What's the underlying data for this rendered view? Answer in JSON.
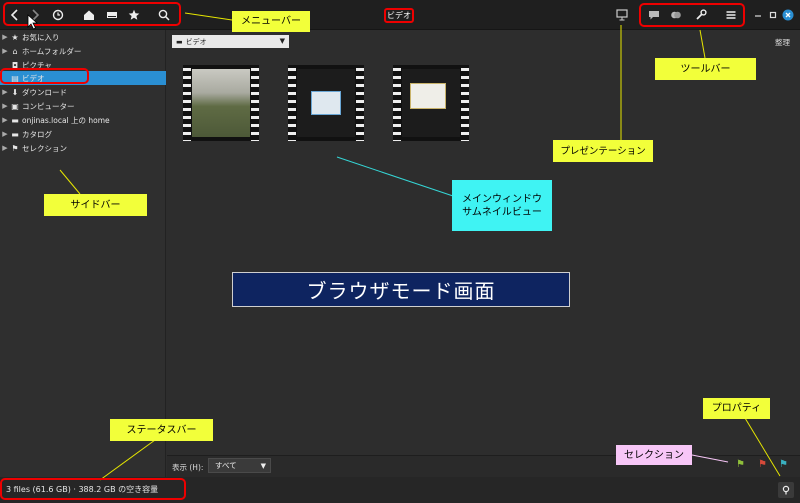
{
  "window": {
    "title": "ビデオ"
  },
  "sidebar": {
    "items": [
      {
        "label": "お気に入り",
        "icon": "star-icon",
        "expandable": true
      },
      {
        "label": "ホームフォルダー",
        "icon": "home-icon",
        "expandable": true
      },
      {
        "label": "ピクチャ",
        "icon": "camera-icon",
        "expandable": false
      },
      {
        "label": "ビデオ",
        "icon": "film-icon",
        "expandable": false,
        "selected": true
      },
      {
        "label": "ダウンロード",
        "icon": "download-icon",
        "expandable": true
      },
      {
        "label": "コンピューター",
        "icon": "computer-icon",
        "expandable": true
      },
      {
        "label": "onjinas.local 上の home",
        "icon": "folder-icon",
        "expandable": true
      },
      {
        "label": "カタログ",
        "icon": "catalog-icon",
        "expandable": true
      },
      {
        "label": "セレクション",
        "icon": "flag-icon",
        "expandable": true
      }
    ]
  },
  "location": {
    "folder": "ビデオ",
    "organize_label": "整理"
  },
  "viewbar": {
    "label": "表示 (H):",
    "selected": "すべて"
  },
  "status": {
    "text": "3 files (61.6 GB)  ·  388.2 GB の空き容量"
  },
  "annotations": {
    "menubar": "メニューバー",
    "toolbar": "ツールバー",
    "presentation": "プレゼンテーション",
    "sidebar": "サイドバー",
    "main_line1": "メインウィンドウ",
    "main_line2": "サムネイルビュー",
    "banner": "ブラウザモード画面",
    "statusbar": "ステータスバー",
    "properties": "プロパティ",
    "selection": "セレクション"
  },
  "colors": {
    "accent": "#2a8fd3",
    "callout": "#f2ff3a",
    "highlight": "#e00000",
    "banner": "#0e2460",
    "selection_callout": "#f7c6f7"
  }
}
